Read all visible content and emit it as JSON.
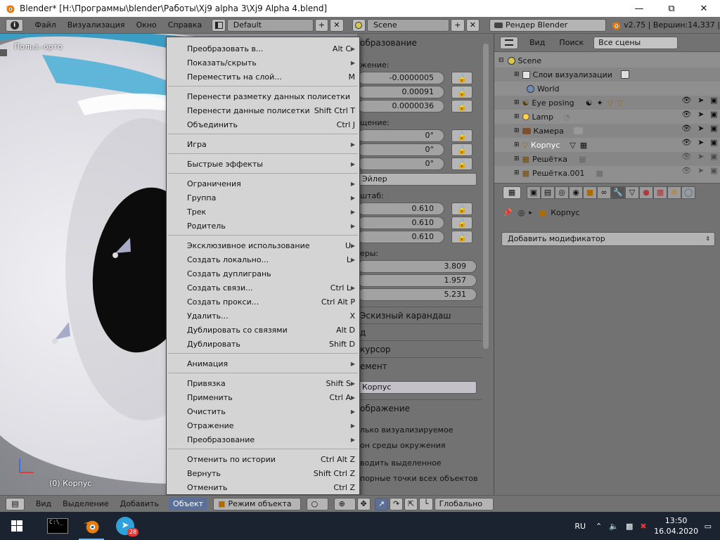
{
  "window": {
    "title": "Blender* [H:\\Программы\\blender\\Работы\\Xj9 alpha 3\\Xj9 Alpha 4.blend]",
    "minimize_icon": "minimize-icon",
    "maximize_icon": "restore-icon",
    "close_icon": "close-icon"
  },
  "topbar": {
    "menus": [
      "Файл",
      "Визуализация",
      "Окно",
      "Справка"
    ],
    "layout": "Default",
    "scene": "Scene",
    "engine": "Рендер Blender",
    "version_info": "v2.75 | Вершин:14,337 | "
  },
  "viewport": {
    "view_label": "Польз.-орто",
    "object_label": "(0) Корпус"
  },
  "properties_behind": {
    "panel_title_transform": "образование",
    "location_label": "жение:",
    "location": [
      "-0.0000005",
      "0.00091",
      "0.0000036"
    ],
    "rotation_label": "щение:",
    "rotation": [
      "0°",
      "0°",
      "0°"
    ],
    "rotation_mode": "Эйлер",
    "scale_label": "штаб:",
    "scale": [
      "0.610",
      "0.610",
      "0.610"
    ],
    "dimensions_label": "еры:",
    "dimensions": [
      "3.809",
      "1.957",
      "5.231"
    ],
    "grease_pencil": "Эскизный карандаш",
    "panel_d": "д",
    "cursor": "курсор",
    "item": "емент",
    "item_name": "Корпус",
    "display": "ображение",
    "opt_only_render": "лько визуализируемое",
    "opt_world_bg": "он среды окружения",
    "opt_outline": "водить выделенное",
    "opt_all_origins": "порные точки всех объектов"
  },
  "outliner": {
    "menus": [
      "Вид",
      "Поиск"
    ],
    "filter": "Все сцены",
    "rows": [
      {
        "label": "Scene",
        "indent": 0
      },
      {
        "label": "Слои визуализации",
        "indent": 1
      },
      {
        "label": "World",
        "indent": 1
      },
      {
        "label": "Eye posing",
        "indent": 1
      },
      {
        "label": "Lamp",
        "indent": 1
      },
      {
        "label": "Камера",
        "indent": 1
      },
      {
        "label": "Корпус",
        "indent": 1
      },
      {
        "label": "Решётка",
        "indent": 1
      },
      {
        "label": "Решётка.001",
        "indent": 1
      }
    ]
  },
  "properties": {
    "breadcrumb_object": "Корпус",
    "add_modifier": "Добавить модификатор"
  },
  "context_menu": {
    "items": [
      {
        "label": "Преобразовать в...",
        "shortcut": "Alt C",
        "arrow": true,
        "sep_after": false
      },
      {
        "label": "Показать/скрыть",
        "shortcut": "",
        "arrow": true,
        "sep_after": false
      },
      {
        "label": "Переместить на слой...",
        "shortcut": "M",
        "arrow": false,
        "sep_after": true
      },
      {
        "label": "Перенести разметку данных полисетки",
        "shortcut": "",
        "arrow": false,
        "sep_after": false
      },
      {
        "label": "Перенести данные полисетки",
        "shortcut": "Shift Ctrl T",
        "arrow": false,
        "sep_after": false
      },
      {
        "label": "Объединить",
        "shortcut": "Ctrl J",
        "arrow": false,
        "sep_after": true
      },
      {
        "label": "Игра",
        "shortcut": "",
        "arrow": true,
        "sep_after": true
      },
      {
        "label": "Быстрые эффекты",
        "shortcut": "",
        "arrow": true,
        "sep_after": true
      },
      {
        "label": "Ограничения",
        "shortcut": "",
        "arrow": true,
        "sep_after": false
      },
      {
        "label": "Группа",
        "shortcut": "",
        "arrow": true,
        "sep_after": false
      },
      {
        "label": "Трек",
        "shortcut": "",
        "arrow": true,
        "sep_after": false
      },
      {
        "label": "Родитель",
        "shortcut": "",
        "arrow": true,
        "sep_after": true
      },
      {
        "label": "Эксклюзивное использование",
        "shortcut": "U",
        "arrow": true,
        "sep_after": false
      },
      {
        "label": "Создать локально...",
        "shortcut": "L",
        "arrow": true,
        "sep_after": false
      },
      {
        "label": "Создать дуплигрань",
        "shortcut": "",
        "arrow": false,
        "sep_after": false
      },
      {
        "label": "Создать связи...",
        "shortcut": "Ctrl L",
        "arrow": true,
        "sep_after": false
      },
      {
        "label": "Создать прокси...",
        "shortcut": "Ctrl Alt P",
        "arrow": false,
        "sep_after": false
      },
      {
        "label": "Удалить...",
        "shortcut": "X",
        "arrow": false,
        "sep_after": false
      },
      {
        "label": "Дублировать со связями",
        "shortcut": "Alt D",
        "arrow": false,
        "sep_after": false
      },
      {
        "label": "Дублировать",
        "shortcut": "Shift D",
        "arrow": false,
        "sep_after": true
      },
      {
        "label": "Анимация",
        "shortcut": "",
        "arrow": true,
        "sep_after": true
      },
      {
        "label": "Привязка",
        "shortcut": "Shift S",
        "arrow": true,
        "sep_after": false
      },
      {
        "label": "Применить",
        "shortcut": "Ctrl A",
        "arrow": true,
        "sep_after": false
      },
      {
        "label": "Очистить",
        "shortcut": "",
        "arrow": true,
        "sep_after": false
      },
      {
        "label": "Отражение",
        "shortcut": "",
        "arrow": true,
        "sep_after": false
      },
      {
        "label": "Преобразование",
        "shortcut": "",
        "arrow": true,
        "sep_after": true
      },
      {
        "label": "Отменить по истории",
        "shortcut": "Ctrl Alt Z",
        "arrow": false,
        "sep_after": false
      },
      {
        "label": "Вернуть",
        "shortcut": "Shift Ctrl Z",
        "arrow": false,
        "sep_after": false
      },
      {
        "label": "Отменить",
        "shortcut": "Ctrl Z",
        "arrow": false,
        "sep_after": false
      }
    ]
  },
  "bottombar": {
    "menus": [
      "Вид",
      "Выделение",
      "Добавить",
      "Объект"
    ],
    "mode": "Режим объекта",
    "orientation": "Глобально"
  },
  "taskbar": {
    "telegram_badge": "28",
    "lang": "RU",
    "time": "13:50",
    "date": "16.04.2020"
  }
}
